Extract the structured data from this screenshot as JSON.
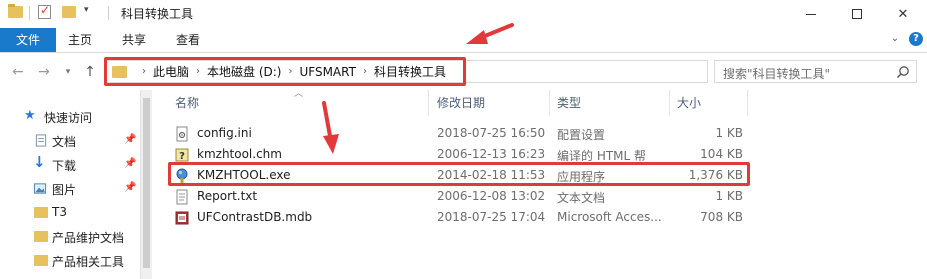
{
  "window": {
    "title": "科目转换工具",
    "controls": {
      "minimize_icon": "minimize-icon",
      "maximize_icon": "maximize-icon",
      "close_icon": "close-icon"
    }
  },
  "ribbon": {
    "tabs": [
      {
        "label": "文件",
        "active": true
      },
      {
        "label": "主页"
      },
      {
        "label": "共享"
      },
      {
        "label": "查看"
      }
    ],
    "accent_color": "#1979ca"
  },
  "navigation": {
    "breadcrumb": [
      "此电脑",
      "本地磁盘 (D:)",
      "UFSMART",
      "科目转换工具"
    ],
    "search_placeholder": "搜索\"科目转换工具\""
  },
  "sidebar": {
    "items": [
      {
        "label": "快速访问",
        "icon": "star-icon",
        "pinned": false
      },
      {
        "label": "文档",
        "icon": "document-icon",
        "pinned": true
      },
      {
        "label": "下载",
        "icon": "download-icon",
        "pinned": true
      },
      {
        "label": "图片",
        "icon": "picture-icon",
        "pinned": true
      },
      {
        "label": "T3",
        "icon": "folder-icon",
        "pinned": false
      },
      {
        "label": "产品维护文档",
        "icon": "folder-icon",
        "pinned": false
      },
      {
        "label": "产品相关工具",
        "icon": "folder-icon",
        "pinned": false
      }
    ]
  },
  "file_list": {
    "columns": [
      "名称",
      "修改日期",
      "类型",
      "大小"
    ],
    "rows": [
      {
        "name": "config.ini",
        "date": "2018-07-25 16:50",
        "type": "配置设置",
        "size": "1 KB",
        "icon": "config-file-icon"
      },
      {
        "name": "kmzhtool.chm",
        "date": "2006-12-13 16:23",
        "type": "编译的 HTML 帮",
        "size": "104 KB",
        "icon": "help-file-icon"
      },
      {
        "name": "KMZHTOOL.exe",
        "date": "2014-02-18 11:53",
        "type": "应用程序",
        "size": "1,376 KB",
        "icon": "exe-file-icon",
        "highlighted": true
      },
      {
        "name": "Report.txt",
        "date": "2006-12-08 13:02",
        "type": "文本文档",
        "size": "1 KB",
        "icon": "text-file-icon"
      },
      {
        "name": "UFContrastDB.mdb",
        "date": "2018-07-25 17:04",
        "type": "Microsoft Acces...",
        "size": "708 KB",
        "icon": "database-file-icon"
      }
    ]
  },
  "annotations": {
    "highlight_color": "#e03a3a"
  }
}
